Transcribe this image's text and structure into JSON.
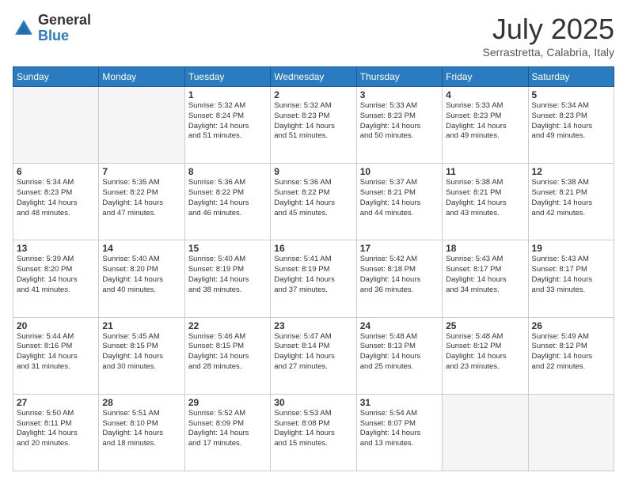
{
  "logo": {
    "general": "General",
    "blue": "Blue"
  },
  "header": {
    "month": "July 2025",
    "location": "Serrastretta, Calabria, Italy"
  },
  "weekdays": [
    "Sunday",
    "Monday",
    "Tuesday",
    "Wednesday",
    "Thursday",
    "Friday",
    "Saturday"
  ],
  "weeks": [
    [
      {
        "day": "",
        "lines": [],
        "empty": true
      },
      {
        "day": "",
        "lines": [],
        "empty": true
      },
      {
        "day": "1",
        "lines": [
          "Sunrise: 5:32 AM",
          "Sunset: 8:24 PM",
          "Daylight: 14 hours",
          "and 51 minutes."
        ],
        "empty": false
      },
      {
        "day": "2",
        "lines": [
          "Sunrise: 5:32 AM",
          "Sunset: 8:23 PM",
          "Daylight: 14 hours",
          "and 51 minutes."
        ],
        "empty": false
      },
      {
        "day": "3",
        "lines": [
          "Sunrise: 5:33 AM",
          "Sunset: 8:23 PM",
          "Daylight: 14 hours",
          "and 50 minutes."
        ],
        "empty": false
      },
      {
        "day": "4",
        "lines": [
          "Sunrise: 5:33 AM",
          "Sunset: 8:23 PM",
          "Daylight: 14 hours",
          "and 49 minutes."
        ],
        "empty": false
      },
      {
        "day": "5",
        "lines": [
          "Sunrise: 5:34 AM",
          "Sunset: 8:23 PM",
          "Daylight: 14 hours",
          "and 49 minutes."
        ],
        "empty": false
      }
    ],
    [
      {
        "day": "6",
        "lines": [
          "Sunrise: 5:34 AM",
          "Sunset: 8:23 PM",
          "Daylight: 14 hours",
          "and 48 minutes."
        ],
        "empty": false
      },
      {
        "day": "7",
        "lines": [
          "Sunrise: 5:35 AM",
          "Sunset: 8:22 PM",
          "Daylight: 14 hours",
          "and 47 minutes."
        ],
        "empty": false
      },
      {
        "day": "8",
        "lines": [
          "Sunrise: 5:36 AM",
          "Sunset: 8:22 PM",
          "Daylight: 14 hours",
          "and 46 minutes."
        ],
        "empty": false
      },
      {
        "day": "9",
        "lines": [
          "Sunrise: 5:36 AM",
          "Sunset: 8:22 PM",
          "Daylight: 14 hours",
          "and 45 minutes."
        ],
        "empty": false
      },
      {
        "day": "10",
        "lines": [
          "Sunrise: 5:37 AM",
          "Sunset: 8:21 PM",
          "Daylight: 14 hours",
          "and 44 minutes."
        ],
        "empty": false
      },
      {
        "day": "11",
        "lines": [
          "Sunrise: 5:38 AM",
          "Sunset: 8:21 PM",
          "Daylight: 14 hours",
          "and 43 minutes."
        ],
        "empty": false
      },
      {
        "day": "12",
        "lines": [
          "Sunrise: 5:38 AM",
          "Sunset: 8:21 PM",
          "Daylight: 14 hours",
          "and 42 minutes."
        ],
        "empty": false
      }
    ],
    [
      {
        "day": "13",
        "lines": [
          "Sunrise: 5:39 AM",
          "Sunset: 8:20 PM",
          "Daylight: 14 hours",
          "and 41 minutes."
        ],
        "empty": false
      },
      {
        "day": "14",
        "lines": [
          "Sunrise: 5:40 AM",
          "Sunset: 8:20 PM",
          "Daylight: 14 hours",
          "and 40 minutes."
        ],
        "empty": false
      },
      {
        "day": "15",
        "lines": [
          "Sunrise: 5:40 AM",
          "Sunset: 8:19 PM",
          "Daylight: 14 hours",
          "and 38 minutes."
        ],
        "empty": false
      },
      {
        "day": "16",
        "lines": [
          "Sunrise: 5:41 AM",
          "Sunset: 8:19 PM",
          "Daylight: 14 hours",
          "and 37 minutes."
        ],
        "empty": false
      },
      {
        "day": "17",
        "lines": [
          "Sunrise: 5:42 AM",
          "Sunset: 8:18 PM",
          "Daylight: 14 hours",
          "and 36 minutes."
        ],
        "empty": false
      },
      {
        "day": "18",
        "lines": [
          "Sunrise: 5:43 AM",
          "Sunset: 8:17 PM",
          "Daylight: 14 hours",
          "and 34 minutes."
        ],
        "empty": false
      },
      {
        "day": "19",
        "lines": [
          "Sunrise: 5:43 AM",
          "Sunset: 8:17 PM",
          "Daylight: 14 hours",
          "and 33 minutes."
        ],
        "empty": false
      }
    ],
    [
      {
        "day": "20",
        "lines": [
          "Sunrise: 5:44 AM",
          "Sunset: 8:16 PM",
          "Daylight: 14 hours",
          "and 31 minutes."
        ],
        "empty": false
      },
      {
        "day": "21",
        "lines": [
          "Sunrise: 5:45 AM",
          "Sunset: 8:15 PM",
          "Daylight: 14 hours",
          "and 30 minutes."
        ],
        "empty": false
      },
      {
        "day": "22",
        "lines": [
          "Sunrise: 5:46 AM",
          "Sunset: 8:15 PM",
          "Daylight: 14 hours",
          "and 28 minutes."
        ],
        "empty": false
      },
      {
        "day": "23",
        "lines": [
          "Sunrise: 5:47 AM",
          "Sunset: 8:14 PM",
          "Daylight: 14 hours",
          "and 27 minutes."
        ],
        "empty": false
      },
      {
        "day": "24",
        "lines": [
          "Sunrise: 5:48 AM",
          "Sunset: 8:13 PM",
          "Daylight: 14 hours",
          "and 25 minutes."
        ],
        "empty": false
      },
      {
        "day": "25",
        "lines": [
          "Sunrise: 5:48 AM",
          "Sunset: 8:12 PM",
          "Daylight: 14 hours",
          "and 23 minutes."
        ],
        "empty": false
      },
      {
        "day": "26",
        "lines": [
          "Sunrise: 5:49 AM",
          "Sunset: 8:12 PM",
          "Daylight: 14 hours",
          "and 22 minutes."
        ],
        "empty": false
      }
    ],
    [
      {
        "day": "27",
        "lines": [
          "Sunrise: 5:50 AM",
          "Sunset: 8:11 PM",
          "Daylight: 14 hours",
          "and 20 minutes."
        ],
        "empty": false
      },
      {
        "day": "28",
        "lines": [
          "Sunrise: 5:51 AM",
          "Sunset: 8:10 PM",
          "Daylight: 14 hours",
          "and 18 minutes."
        ],
        "empty": false
      },
      {
        "day": "29",
        "lines": [
          "Sunrise: 5:52 AM",
          "Sunset: 8:09 PM",
          "Daylight: 14 hours",
          "and 17 minutes."
        ],
        "empty": false
      },
      {
        "day": "30",
        "lines": [
          "Sunrise: 5:53 AM",
          "Sunset: 8:08 PM",
          "Daylight: 14 hours",
          "and 15 minutes."
        ],
        "empty": false
      },
      {
        "day": "31",
        "lines": [
          "Sunrise: 5:54 AM",
          "Sunset: 8:07 PM",
          "Daylight: 14 hours",
          "and 13 minutes."
        ],
        "empty": false
      },
      {
        "day": "",
        "lines": [],
        "empty": true
      },
      {
        "day": "",
        "lines": [],
        "empty": true
      }
    ]
  ]
}
